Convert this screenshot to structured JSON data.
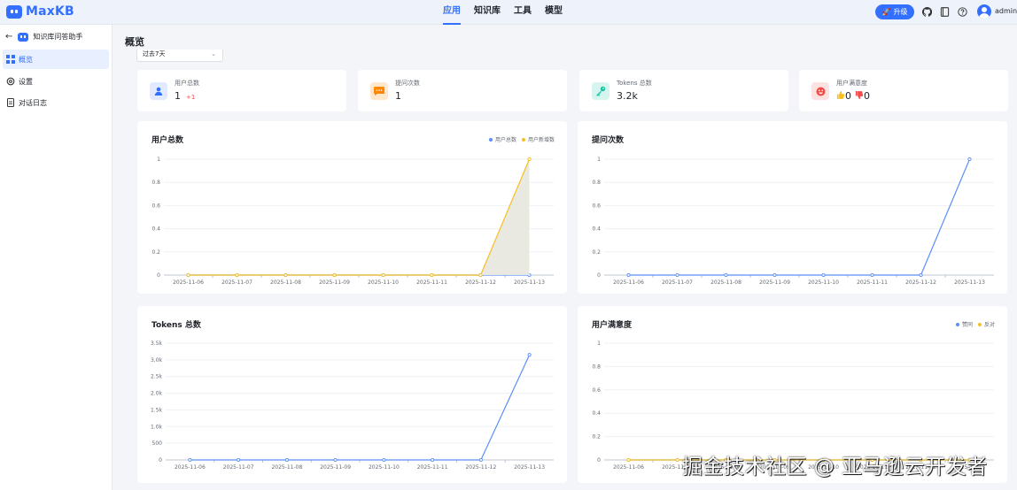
{
  "header": {
    "logo_text": "MaxKB",
    "nav": [
      {
        "label": "应用",
        "active": true
      },
      {
        "label": "知识库",
        "active": false
      },
      {
        "label": "工具",
        "active": false
      },
      {
        "label": "模型",
        "active": false
      }
    ],
    "upgrade_label": "升级",
    "user_name": "admin",
    "icons": [
      "github-icon",
      "book-icon",
      "help-icon"
    ],
    "accent_color": "#3370ff"
  },
  "sidebar": {
    "app_name": "知识库问答助手",
    "items": [
      {
        "label": "概览",
        "icon": "grid-icon",
        "active": true
      },
      {
        "label": "设置",
        "icon": "gear-icon",
        "active": false
      },
      {
        "label": "对话日志",
        "icon": "document-icon",
        "active": false
      }
    ]
  },
  "main": {
    "title": "概览",
    "date_range": "过去7天"
  },
  "stats": [
    {
      "label": "用户总数",
      "value": "1",
      "delta": "+1",
      "icon": "user-icon",
      "color": "#3370ff"
    },
    {
      "label": "提问次数",
      "value": "1",
      "icon": "message-icon",
      "color": "#ff8800"
    },
    {
      "label": "Tokens 总数",
      "value": "3.2k",
      "icon": "key-icon",
      "color": "#14c0a0"
    },
    {
      "label": "用户满意度",
      "up": "0",
      "down": "0",
      "icon": "smile-icon",
      "color": "#f54a45"
    }
  ],
  "chart_data": [
    {
      "type": "area",
      "title": "用户总数",
      "x": [
        "2025-11-06",
        "2025-11-07",
        "2025-11-08",
        "2025-11-09",
        "2025-11-10",
        "2025-11-11",
        "2025-11-12",
        "2025-11-13"
      ],
      "series": [
        {
          "name": "用户总数",
          "color": "#5b8ff9",
          "values": [
            0,
            0,
            0,
            0,
            0,
            0,
            0,
            0
          ]
        },
        {
          "name": "用户新增数",
          "color": "#f6c022",
          "values": [
            0,
            0,
            0,
            0,
            0,
            0,
            0,
            1
          ],
          "filled": true
        }
      ],
      "y_ticks": [
        "0",
        "0.2",
        "0.4",
        "0.6",
        "0.8",
        "1"
      ],
      "ylim": [
        0,
        1
      ],
      "legend": "top-right"
    },
    {
      "type": "line",
      "title": "提问次数",
      "x": [
        "2025-11-06",
        "2025-11-07",
        "2025-11-08",
        "2025-11-09",
        "2025-11-10",
        "2025-11-11",
        "2025-11-12",
        "2025-11-13"
      ],
      "series": [
        {
          "color": "#5b8ff9",
          "values": [
            0,
            0,
            0,
            0,
            0,
            0,
            0,
            1
          ]
        }
      ],
      "y_ticks": [
        "0",
        "0.2",
        "0.4",
        "0.6",
        "0.8",
        "1"
      ],
      "ylim": [
        0,
        1
      ]
    },
    {
      "type": "line",
      "title": "Tokens 总数",
      "x": [
        "2025-11-06",
        "2025-11-07",
        "2025-11-08",
        "2025-11-09",
        "2025-11-10",
        "2025-11-11",
        "2025-11-12",
        "2025-11-13"
      ],
      "series": [
        {
          "color": "#5b8ff9",
          "values": [
            0,
            0,
            0,
            0,
            0,
            0,
            0,
            3150
          ]
        }
      ],
      "y_ticks": [
        "0",
        "500",
        "1.0k",
        "1.5k",
        "2.0k",
        "2.5k",
        "3.0k",
        "3.5k"
      ],
      "ylim": [
        0,
        3500
      ]
    },
    {
      "type": "line",
      "title": "用户满意度",
      "x": [
        "2025-11-06",
        "2025-11-07",
        "2025-11-08",
        "2025-11-09",
        "2025-11-10",
        "2025-11-11",
        "2025-11-12",
        "2025-11-13"
      ],
      "series": [
        {
          "name": "赞同",
          "color": "#5b8ff9",
          "values": [
            0,
            0,
            0,
            0,
            0,
            0,
            0,
            0
          ]
        },
        {
          "name": "反对",
          "color": "#f6c022",
          "values": [
            0,
            0,
            0,
            0,
            0,
            0,
            0,
            0
          ]
        }
      ],
      "y_ticks": [
        "0",
        "0.2",
        "0.4",
        "0.6",
        "0.8",
        "1"
      ],
      "ylim": [
        0,
        1
      ],
      "legend": "top-right"
    }
  ],
  "watermark": "掘金技术社区 @ 亚马逊云开发者"
}
